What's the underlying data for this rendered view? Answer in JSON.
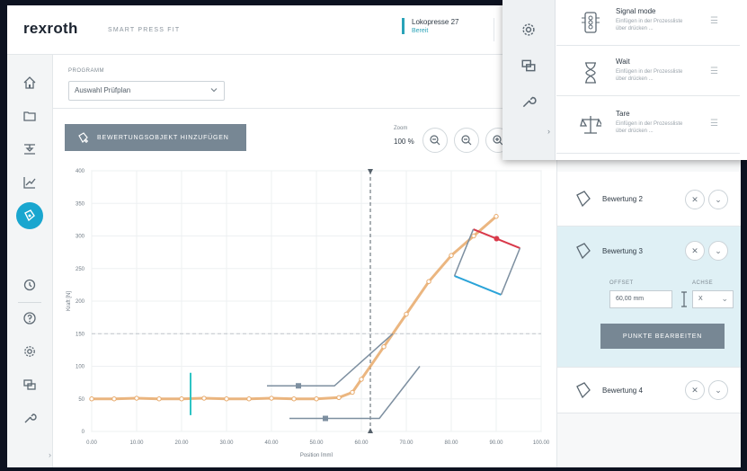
{
  "app": {
    "logo": "rexroth",
    "subtitle": "SMART PRESS FIT",
    "machine_name": "Lokopresse 27",
    "machine_status": "Bereit"
  },
  "colors": {
    "accent": "#19a6cf",
    "button": "#778794",
    "curve": "#e7a96a",
    "window_red": "#d9394a",
    "window_blue": "#2aa3d8",
    "tolerance_line": "#7d8fa0"
  },
  "sidebar": {
    "items": [
      {
        "icon": "home-icon"
      },
      {
        "icon": "folder-icon"
      },
      {
        "icon": "press-icon"
      },
      {
        "icon": "chart-icon"
      },
      {
        "icon": "evaluation-icon",
        "active": true
      },
      {
        "icon": "history-icon"
      },
      {
        "icon": "help-icon"
      },
      {
        "icon": "settings-icon"
      },
      {
        "icon": "network-icon"
      },
      {
        "icon": "wrench-icon"
      }
    ]
  },
  "program": {
    "label": "PROGRAMM",
    "value": "Auswahl Prüfplan"
  },
  "toolbar": {
    "add_button": "BEWERTUNGSOBJEKT HINZUFÜGEN",
    "zoom_label": "Zoom",
    "zoom_value": "100 %"
  },
  "chart_data": {
    "type": "line",
    "xlabel": "Position [mm]",
    "ylabel": "Kraft [N]",
    "x_ticks": [
      "0.00",
      "10.00",
      "20.00",
      "30.00",
      "40.00",
      "50.00",
      "60.00",
      "70.00",
      "80.00",
      "90.00",
      "100.00"
    ],
    "y_ticks": [
      "0",
      "50",
      "100",
      "150",
      "200",
      "250",
      "300",
      "350",
      "400"
    ],
    "xlim": [
      0,
      100
    ],
    "ylim": [
      0,
      400
    ],
    "grid": true,
    "series": [
      {
        "x": [
          0,
          5,
          10,
          15,
          20,
          25,
          30,
          35,
          40,
          45,
          50,
          55,
          58,
          60,
          65,
          70,
          75,
          80,
          85,
          90
        ],
        "y": [
          50,
          50,
          51,
          50,
          50,
          51,
          50,
          50,
          51,
          50,
          50,
          52,
          60,
          80,
          130,
          180,
          230,
          270,
          300,
          330
        ]
      }
    ],
    "reference_x": 62,
    "reference_y": 150
  },
  "panel": {
    "cards": [
      {
        "title": "Bewertung 2"
      },
      {
        "title": "Bewertung 3",
        "offset_label": "OFFSET",
        "offset_value": "60,00 mm",
        "achse_label": "ACHSE",
        "achse_value": "X",
        "edit_button": "PUNKTE BEARBEITEN"
      },
      {
        "title": "Bewertung 4"
      }
    ]
  },
  "popup": {
    "items": [
      {
        "title": "Signal mode",
        "desc": "Einfügen in der Prozessliste über drücken ..."
      },
      {
        "title": "Wait",
        "desc": "Einfügen in der Prozessliste über drücken ..."
      },
      {
        "title": "Tare",
        "desc": "Einfügen in der Prozessliste über drücken ..."
      }
    ]
  }
}
